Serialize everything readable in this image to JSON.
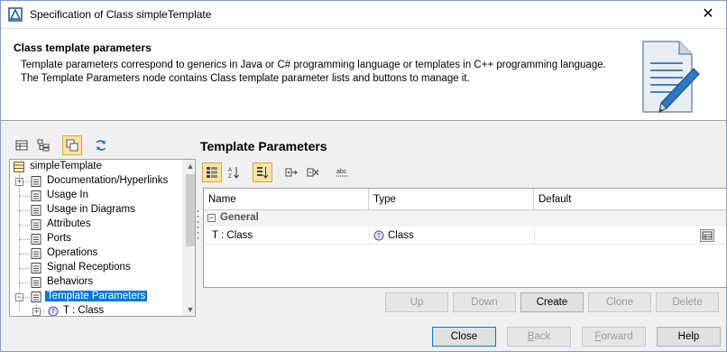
{
  "window": {
    "title": "Specification of Class simpleTemplate",
    "close_glyph": "✕"
  },
  "header": {
    "title": "Class template parameters",
    "description": "Template parameters correspond to generics in Java or C# programming language or templates in C++ programming language. The Template Parameters node contains Class template parameter lists and buttons to manage it.",
    "image_icon": "document-pencil-icon"
  },
  "left_toolbar": {
    "buttons": [
      {
        "name": "table-view-icon",
        "active": false
      },
      {
        "name": "tree-view-icon",
        "active": false
      },
      {
        "name": "copy-view-icon",
        "active": true
      },
      {
        "name": "refresh-icon",
        "active": false
      }
    ]
  },
  "tree": {
    "root": "simpleTemplate",
    "items": [
      {
        "label": "Documentation/Hyperlinks",
        "expandable": true
      },
      {
        "label": "Usage In",
        "expandable": false
      },
      {
        "label": "Usage in Diagrams",
        "expandable": false
      },
      {
        "label": "Attributes",
        "expandable": false
      },
      {
        "label": "Ports",
        "expandable": false
      },
      {
        "label": "Operations",
        "expandable": false
      },
      {
        "label": "Signal Receptions",
        "expandable": false
      },
      {
        "label": "Behaviors",
        "expandable": false
      },
      {
        "label": "Template Parameters",
        "expandable": true,
        "selected": true
      }
    ],
    "child": "T : Class"
  },
  "panel": {
    "title": "Template Parameters",
    "toolbar_icons": [
      "categorize-icon",
      "sort-az-icon",
      "sort-icon",
      "expand-icon",
      "collapse-icon",
      "abc-icon"
    ]
  },
  "grid": {
    "columns": [
      "Name",
      "Type",
      "Default"
    ],
    "group": "General",
    "rows": [
      {
        "name": "T : Class",
        "type": "Class",
        "default": ""
      }
    ]
  },
  "action_buttons": {
    "up": "Up",
    "down": "Down",
    "create": "Create",
    "clone": "Clone",
    "delete": "Delete"
  },
  "footer_buttons": {
    "close": "Close",
    "back_prefix": "",
    "back_mnemonic": "B",
    "back_rest": "ack",
    "forward_prefix": "",
    "forward_mnemonic": "F",
    "forward_rest": "orward",
    "help": "Help"
  },
  "colors": {
    "selection": "#0078d7",
    "active_toolbar": "#fbe3a8"
  }
}
